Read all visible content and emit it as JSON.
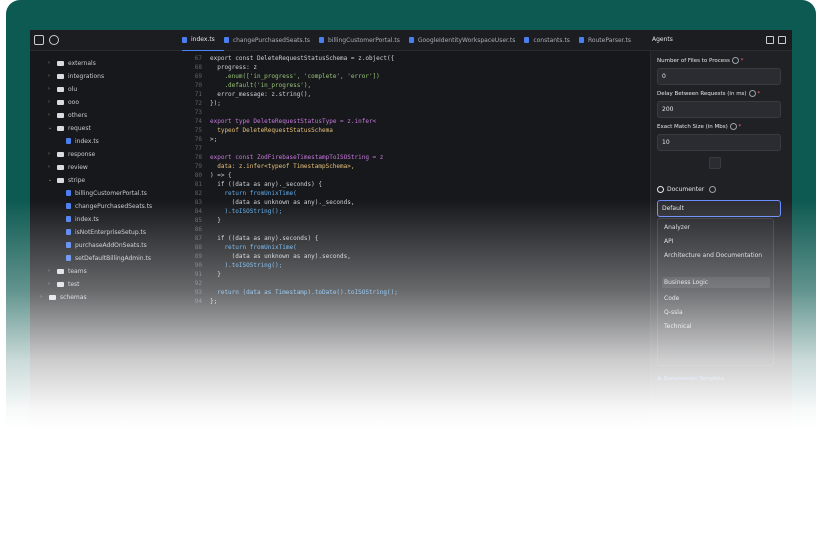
{
  "tabs": [
    {
      "label": "index.ts",
      "active": true
    },
    {
      "label": "changePurchasedSeats.ts",
      "active": false
    },
    {
      "label": "billingCustomerPortal.ts",
      "active": false
    },
    {
      "label": "GoogleIdentityWorkspaceUser.ts",
      "active": false
    },
    {
      "label": "constants.ts",
      "active": false
    },
    {
      "label": "RouteParser.ts",
      "active": false
    }
  ],
  "tree": [
    {
      "label": "externals",
      "type": "folder"
    },
    {
      "label": "integrations",
      "type": "folder"
    },
    {
      "label": "olu",
      "type": "folder"
    },
    {
      "label": "ooo",
      "type": "folder"
    },
    {
      "label": "others",
      "type": "folder"
    },
    {
      "label": "request",
      "type": "folder"
    },
    {
      "label": "index.ts",
      "type": "file"
    },
    {
      "label": "response",
      "type": "folder"
    },
    {
      "label": "review",
      "type": "folder"
    },
    {
      "label": "stripe",
      "type": "folder"
    },
    {
      "label": "billingCustomerPortal.ts",
      "type": "file"
    },
    {
      "label": "changePurchasedSeats.ts",
      "type": "file"
    },
    {
      "label": "index.ts",
      "type": "file"
    },
    {
      "label": "isNotEnterpriseSetup.ts",
      "type": "file"
    },
    {
      "label": "purchaseAddOnSeats.ts",
      "type": "file"
    },
    {
      "label": "setDefaultBillingAdmin.ts",
      "type": "file"
    },
    {
      "label": "teams",
      "type": "folder"
    },
    {
      "label": "test",
      "type": "folder"
    },
    {
      "label": "schemas",
      "type": "folder"
    }
  ],
  "code": [
    {
      "n": "67",
      "t": "export const DeleteRequestStatusSchema = z.object({"
    },
    {
      "n": "68",
      "t": "  progress: z"
    },
    {
      "n": "69",
      "t": "    .enum(['in_progress', 'complete', 'error'])"
    },
    {
      "n": "70",
      "t": "    .default('in_progress'),"
    },
    {
      "n": "71",
      "t": "  error_message: z.string(),"
    },
    {
      "n": "72",
      "t": "});"
    },
    {
      "n": "73",
      "t": ""
    },
    {
      "n": "74",
      "t": "export type DeleteRequestStatusType = z.infer<"
    },
    {
      "n": "75",
      "t": "  typeof DeleteRequestStatusSchema"
    },
    {
      "n": "76",
      "t": ">;"
    },
    {
      "n": "77",
      "t": ""
    },
    {
      "n": "78",
      "t": "export const ZodFirebaseTimestampToISOString = z"
    },
    {
      "n": "79",
      "t": "  data: z.infer<typeof TimestampSchema>,"
    },
    {
      "n": "80",
      "t": ") => {"
    },
    {
      "n": "81",
      "t": "  if ((data as any)._seconds) {"
    },
    {
      "n": "82",
      "t": "    return fromUnixTime("
    },
    {
      "n": "83",
      "t": "      (data as unknown as any)._seconds,"
    },
    {
      "n": "84",
      "t": "    ).toISOString();"
    },
    {
      "n": "85",
      "t": "  }"
    },
    {
      "n": "86",
      "t": ""
    },
    {
      "n": "87",
      "t": "  if ((data as any).seconds) {"
    },
    {
      "n": "88",
      "t": "    return fromUnixTime("
    },
    {
      "n": "89",
      "t": "      (data as unknown as any).seconds,"
    },
    {
      "n": "90",
      "t": "    ).toISOString();"
    },
    {
      "n": "91",
      "t": "  }"
    },
    {
      "n": "92",
      "t": ""
    },
    {
      "n": "93",
      "t": "  return (data as Timestamp).toDate().toISOString();"
    },
    {
      "n": "94",
      "t": "};"
    }
  ],
  "agents": {
    "title": "Agents",
    "fields": [
      {
        "label": "Number of Files to Process",
        "value": "0"
      },
      {
        "label": "Delay Between Requests (in ms)",
        "value": "200"
      },
      {
        "label": "Exact Match Size (in Mbs)",
        "value": "10"
      }
    ],
    "documenter_label": "Documenter",
    "select_value": "Default",
    "options": [
      "Analyzer",
      "API",
      "Architecture and Documentation",
      "Business Logic",
      "Code",
      "Q-ssla",
      "Technical"
    ],
    "selected_option": "Business Logic",
    "add_link": "Documenter Template"
  },
  "colors": {
    "bezel": "#0d5a52",
    "screen": "#17181b",
    "accent": "#4b83ff"
  }
}
